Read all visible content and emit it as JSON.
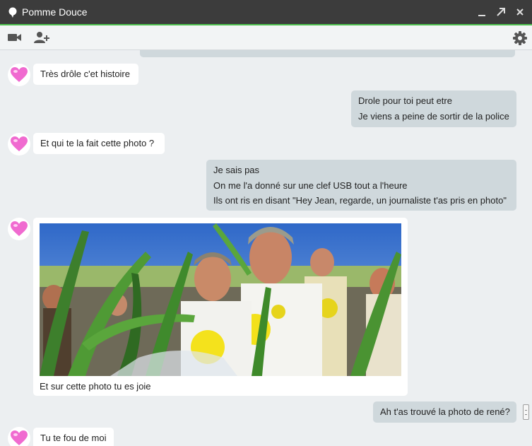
{
  "window": {
    "title": "Pomme Douce",
    "controls": [
      "minimize",
      "popout"
    ]
  },
  "toolbar": {
    "icons": [
      "video-camera-icon",
      "add-person-icon",
      "gear-icon"
    ]
  },
  "messages": [
    {
      "from": "contact",
      "lines": [
        "Très drôle c'et histoire"
      ]
    },
    {
      "from": "me",
      "lines": [
        "Drole pour toi peut etre",
        "Je viens a peine de sortir de la police"
      ]
    },
    {
      "from": "contact",
      "lines": [
        "Et qui te la fait cette photo ?"
      ]
    },
    {
      "from": "me",
      "lines": [
        "Je sais pas",
        "On me l'a donné sur une clef USB tout a l'heure",
        "Ils ont ris en disant \"Hey Jean, regarde, un journaliste t'as pris en photo\""
      ]
    },
    {
      "from": "contact",
      "type": "photo",
      "caption": "Et sur cette photo tu es joie"
    },
    {
      "from": "me",
      "lines": [
        "Ah t'as trouvé la photo de rené?"
      ]
    },
    {
      "from": "contact",
      "lines": [
        "Tu te fou de moi"
      ]
    }
  ],
  "colors": {
    "titlebar": "#3c3c3c",
    "accent": "#4fc14f",
    "outgoing_bubble": "#cfd8dc",
    "incoming_bubble": "#ffffff",
    "background": "#eceff1"
  }
}
